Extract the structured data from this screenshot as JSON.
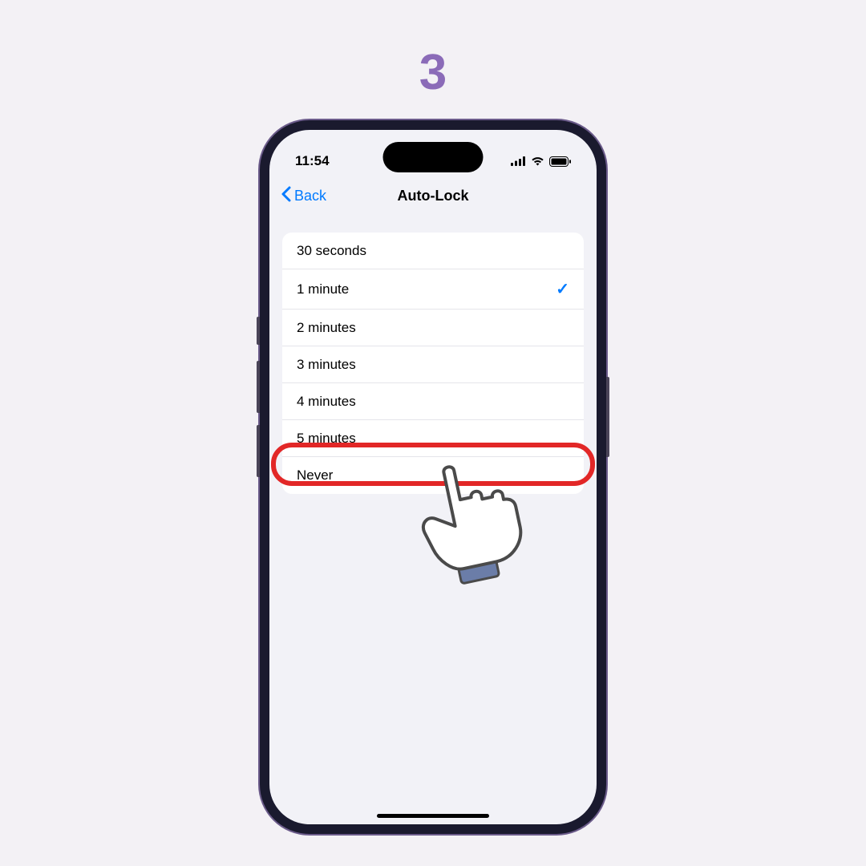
{
  "step_number": "3",
  "status_bar": {
    "time": "11:54"
  },
  "nav": {
    "back_label": "Back",
    "title": "Auto-Lock"
  },
  "list": {
    "items": [
      {
        "label": "30 seconds",
        "selected": false
      },
      {
        "label": "1 minute",
        "selected": true
      },
      {
        "label": "2 minutes",
        "selected": false
      },
      {
        "label": "3 minutes",
        "selected": false
      },
      {
        "label": "4 minutes",
        "selected": false
      },
      {
        "label": "5 minutes",
        "selected": false
      },
      {
        "label": "Never",
        "selected": false
      }
    ]
  },
  "annotation": {
    "highlighted_index": 6,
    "highlight_color": "#e22727"
  }
}
